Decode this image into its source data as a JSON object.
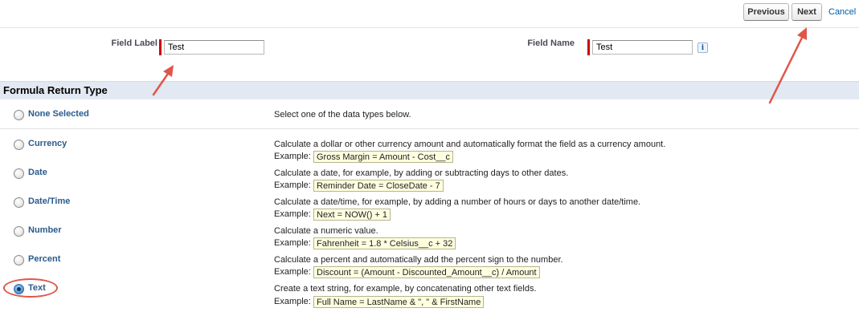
{
  "header": {
    "previous_label": "Previous",
    "next_label": "Next",
    "cancel_label": "Cancel"
  },
  "fields": {
    "field_label": {
      "label": "Field Label",
      "value": "Test"
    },
    "field_name": {
      "label": "Field Name",
      "value": "Test",
      "info_glyph": "i"
    }
  },
  "section_title": "Formula Return Type",
  "return_types": [
    {
      "name": "None Selected",
      "description": "Select one of the data types below.",
      "example": "",
      "selected": false
    },
    {
      "name": "Currency",
      "description": "Calculate a dollar or other currency amount and automatically format the field as a currency amount.",
      "example_label": "Example:",
      "example": "Gross Margin = Amount - Cost__c",
      "selected": false
    },
    {
      "name": "Date",
      "description": "Calculate a date, for example, by adding or subtracting days to other dates.",
      "example_label": "Example:",
      "example": "Reminder Date = CloseDate - 7",
      "selected": false
    },
    {
      "name": "Date/Time",
      "description": "Calculate a date/time, for example, by adding a number of hours or days to another date/time.",
      "example_label": "Example:",
      "example": "Next = NOW() + 1",
      "selected": false
    },
    {
      "name": "Number",
      "description": "Calculate a numeric value.",
      "example_label": "Example:",
      "example": "Fahrenheit = 1.8 * Celsius__c + 32",
      "selected": false
    },
    {
      "name": "Percent",
      "description": "Calculate a percent and automatically add the percent sign to the number.",
      "example_label": "Example:",
      "example": "Discount = (Amount - Discounted_Amount__c) / Amount",
      "selected": false
    },
    {
      "name": "Text",
      "description": "Create a text string, for example, by concatenating other text fields.",
      "example_label": "Example:",
      "example": "Full Name = LastName & \", \" & FirstName",
      "selected": true
    }
  ],
  "colors": {
    "annotation": "#e0564a",
    "required": "#cc0000",
    "section_bg": "#e3e9f2",
    "example_bg": "#ffffe0"
  }
}
